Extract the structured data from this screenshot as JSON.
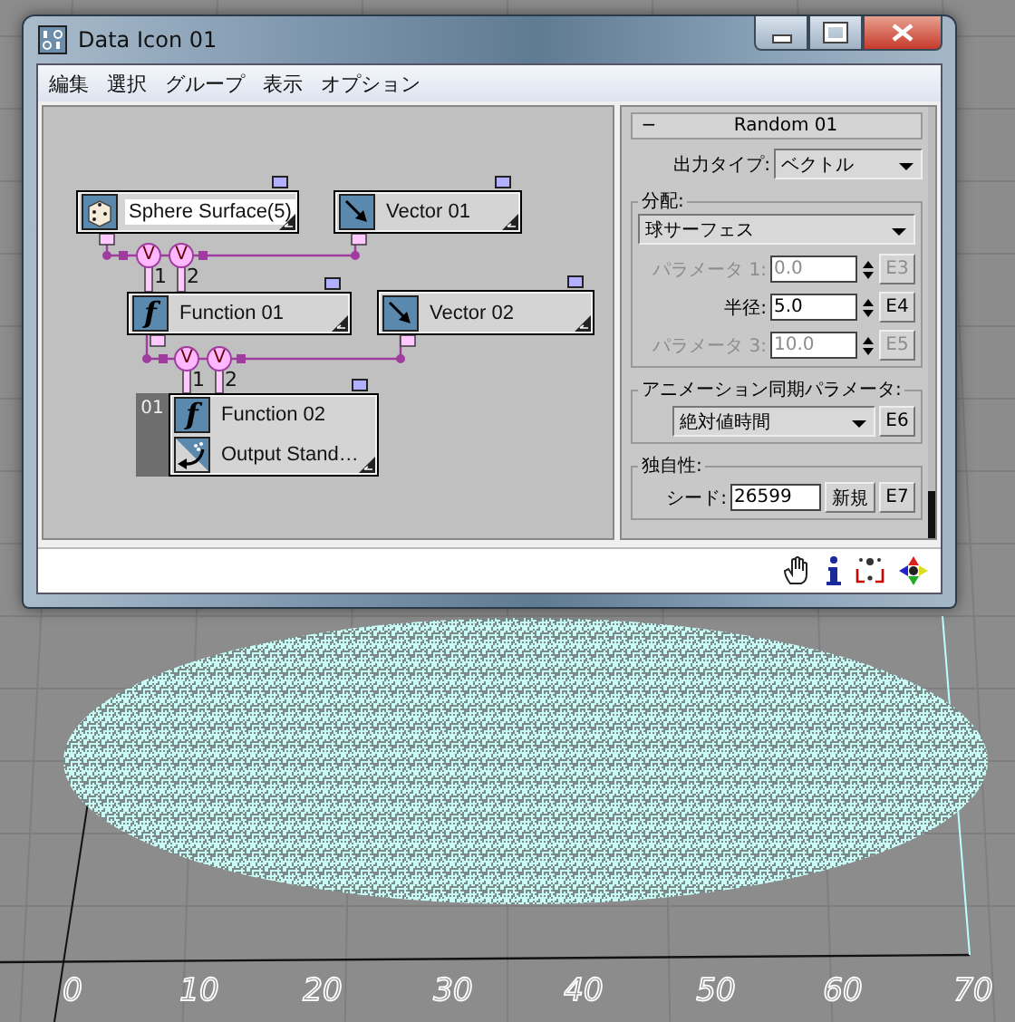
{
  "window": {
    "title": "Data Icon 01"
  },
  "menu": [
    {
      "label": "編集"
    },
    {
      "label": "選択"
    },
    {
      "label": "グループ"
    },
    {
      "label": "表示"
    },
    {
      "label": "オプション"
    }
  ],
  "graph": {
    "nodes": [
      {
        "selected": true,
        "rows": [
          {
            "kind": "random",
            "label": "Sphere Surface(5)"
          }
        ]
      },
      {
        "selected": false,
        "rows": [
          {
            "kind": "vector",
            "label": "Vector 01"
          }
        ]
      },
      {
        "selected": false,
        "rows": [
          {
            "kind": "function",
            "glyph": "f",
            "label": "Function 01"
          }
        ]
      },
      {
        "selected": false,
        "rows": [
          {
            "kind": "vector",
            "label": "Vector 02"
          }
        ]
      },
      {
        "selected": false,
        "badge": "01",
        "rows": [
          {
            "kind": "function",
            "glyph": "f",
            "label": "Function 02"
          },
          {
            "kind": "output",
            "label": "Output Stand…"
          }
        ]
      }
    ],
    "junctions": [
      {
        "symbol": "V",
        "port": "1"
      },
      {
        "symbol": "V",
        "port": "2"
      },
      {
        "symbol": "V",
        "port": "1"
      },
      {
        "symbol": "V",
        "port": "2"
      }
    ]
  },
  "panel": {
    "rollout": {
      "toggle": "−",
      "title": "Random 01"
    },
    "output_type": {
      "label": "出力タイプ:",
      "value": "ベクトル"
    },
    "distribution": {
      "title": "分配:",
      "value": "球サーフェス",
      "params": [
        {
          "label": "パラメータ 1:",
          "value": "0.0",
          "button": "E3",
          "disabled": true
        },
        {
          "label": "半径:",
          "value": "5.0",
          "button": "E4",
          "disabled": false
        },
        {
          "label": "パラメータ 3:",
          "value": "10.0",
          "button": "E5",
          "disabled": true
        }
      ]
    },
    "anim_sync": {
      "title": "アニメーション同期パラメータ:",
      "value": "絶対値時間",
      "button": "E6"
    },
    "uniqueness": {
      "title": "独自性:",
      "seed_label": "シード:",
      "seed": "26599",
      "new_button": "新規",
      "button": "E7"
    }
  },
  "viewport": {
    "axis_labels": [
      "0",
      "10",
      "20",
      "30",
      "40",
      "50",
      "60",
      "70"
    ]
  }
}
